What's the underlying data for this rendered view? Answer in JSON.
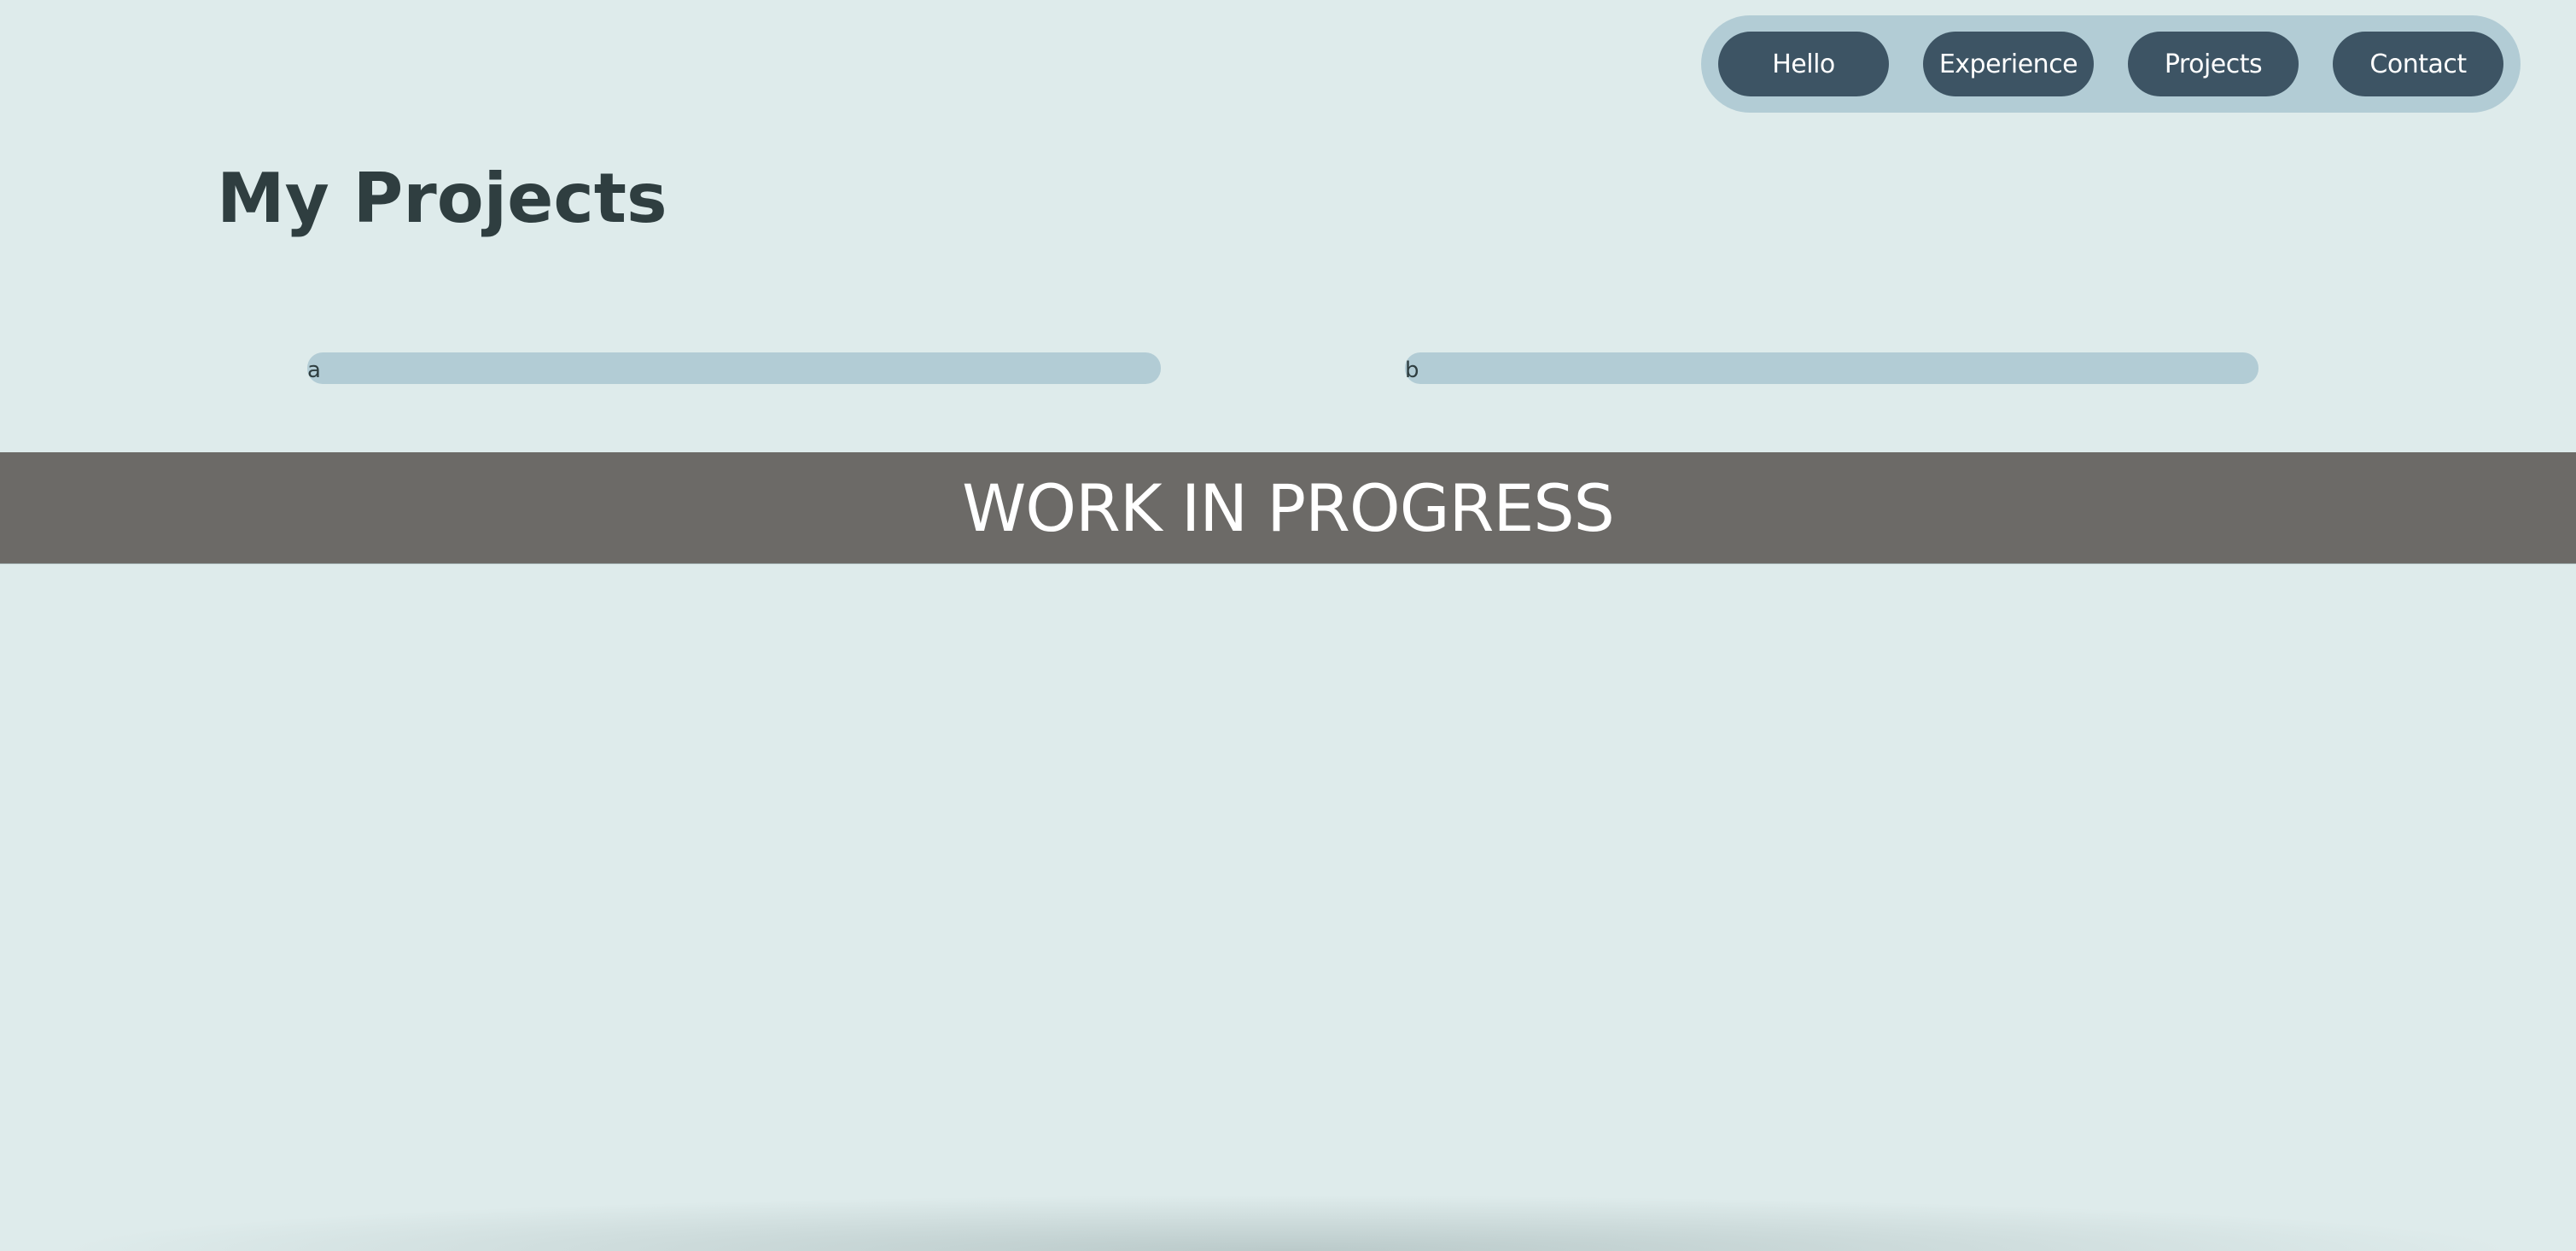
{
  "nav": {
    "items": [
      {
        "label": "Hello"
      },
      {
        "label": "Experience"
      },
      {
        "label": "Projects"
      },
      {
        "label": "Contact"
      }
    ]
  },
  "page": {
    "title": "My Projects"
  },
  "projects": [
    {
      "label": "a"
    },
    {
      "label": "b"
    }
  ],
  "banner": {
    "text": "WORK IN PROGRESS"
  },
  "colors": {
    "background": "#deebeb",
    "nav_pill": "#b2ccd5",
    "nav_button": "#3d5464",
    "title_text": "#2f3e40",
    "banner": "#6c6a67"
  }
}
